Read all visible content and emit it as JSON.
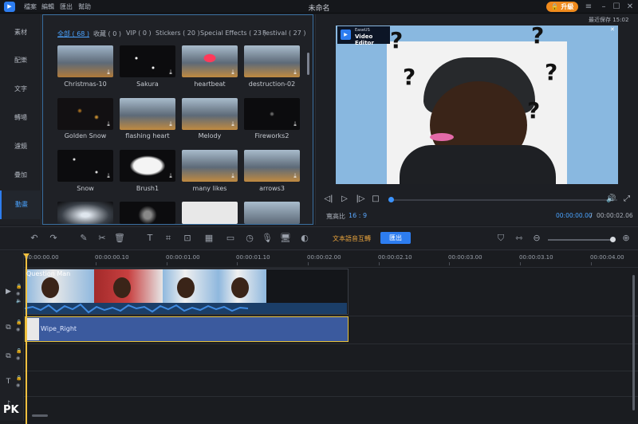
{
  "titlebar": {
    "logo": "EaseUS",
    "menu": [
      "檔案",
      "編輯",
      "匯出",
      "幫助"
    ],
    "title": "未命名",
    "upgrade": "升級"
  },
  "sidebar": [
    "素材",
    "配樂",
    "文字",
    "轉場",
    "濾鏡",
    "疊加",
    "動畫"
  ],
  "library": {
    "tabs": [
      "全部 ( 68 )",
      "收藏 ( 0 )",
      "VIP ( 0 )",
      "Stickers ( 20 )",
      "Special Effects ( 23 )",
      "Festival ( 27 )"
    ],
    "items": [
      "Christmas-10",
      "Sakura",
      "heartbeat",
      "destruction-02",
      "Golden Snow",
      "flashing heart",
      "Melody",
      "Fireworks2",
      "Snow",
      "Brush1",
      "many likes",
      "arrows3",
      "",
      "",
      "",
      ""
    ]
  },
  "preview": {
    "autosave": "最近保存 15:02",
    "brand_small": "EaseUS",
    "brand": "Video Editor",
    "ratio_label": "寬高比",
    "ratio": "16 : 9",
    "time_current": "00:00:00.00",
    "separator": "/",
    "time_total": "00:00:02.06"
  },
  "toolbar": {
    "tts": "文本語音互轉",
    "export": "匯出"
  },
  "timeline": {
    "ticks": [
      "00:00:00.00",
      "00:00:00.10",
      "00:00:01.00",
      "00:00:01.10",
      "00:00:02.00",
      "00:00:02.10",
      "00:00:03.00",
      "00:00:03.10",
      "00:00:04.00"
    ],
    "clip_title": "Question Man",
    "transition": "Wipe_Right"
  },
  "watermark": "PK",
  "colors": {
    "accent": "#2d7df0",
    "upgrade": "#f08a1c",
    "playhead": "#f0c040",
    "transition": "#3b5a9e"
  }
}
